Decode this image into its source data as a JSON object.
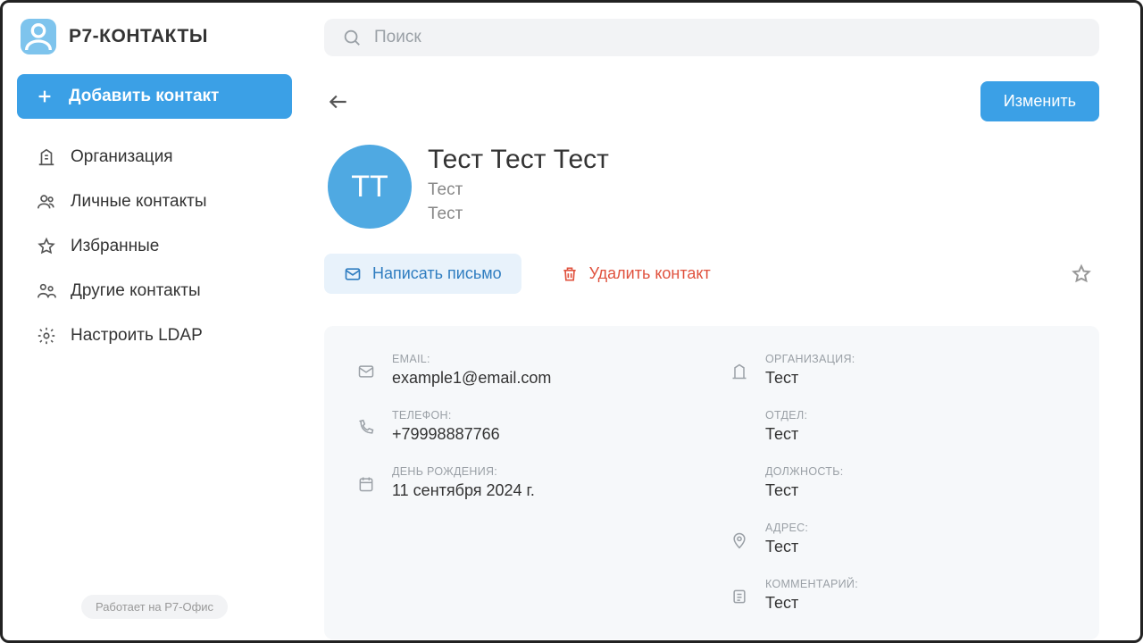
{
  "brand": {
    "title": "Р7-КОНТАКТЫ"
  },
  "sidebar": {
    "add_label": "Добавить контакт",
    "items": [
      {
        "label": "Организация"
      },
      {
        "label": "Личные контакты"
      },
      {
        "label": "Избранные"
      },
      {
        "label": "Другие контакты"
      },
      {
        "label": "Настроить LDAP"
      }
    ],
    "powered": "Работает на Р7-Офис"
  },
  "search": {
    "placeholder": "Поиск"
  },
  "toolbar": {
    "edit_label": "Изменить"
  },
  "contact": {
    "initials": "ТТ",
    "name": "Тест Тест Тест",
    "sub1": "Тест",
    "sub2": "Тест"
  },
  "actions": {
    "email_label": "Написать письмо",
    "delete_label": "Удалить контакт"
  },
  "fields": {
    "email_label": "EMAIL:",
    "email_value": "example1@email.com",
    "phone_label": "ТЕЛЕФОН:",
    "phone_value": "+79998887766",
    "birthday_label": "ДЕНЬ РОЖДЕНИЯ:",
    "birthday_value": "11 сентября 2024 г.",
    "org_label": "ОРГАНИЗАЦИЯ:",
    "org_value": "Тест",
    "dept_label": "ОТДЕЛ:",
    "dept_value": "Тест",
    "position_label": "ДОЛЖНОСТЬ:",
    "position_value": "Тест",
    "address_label": "АДРЕС:",
    "address_value": "Тест",
    "comment_label": "КОММЕНТАРИЙ:",
    "comment_value": "Тест"
  }
}
